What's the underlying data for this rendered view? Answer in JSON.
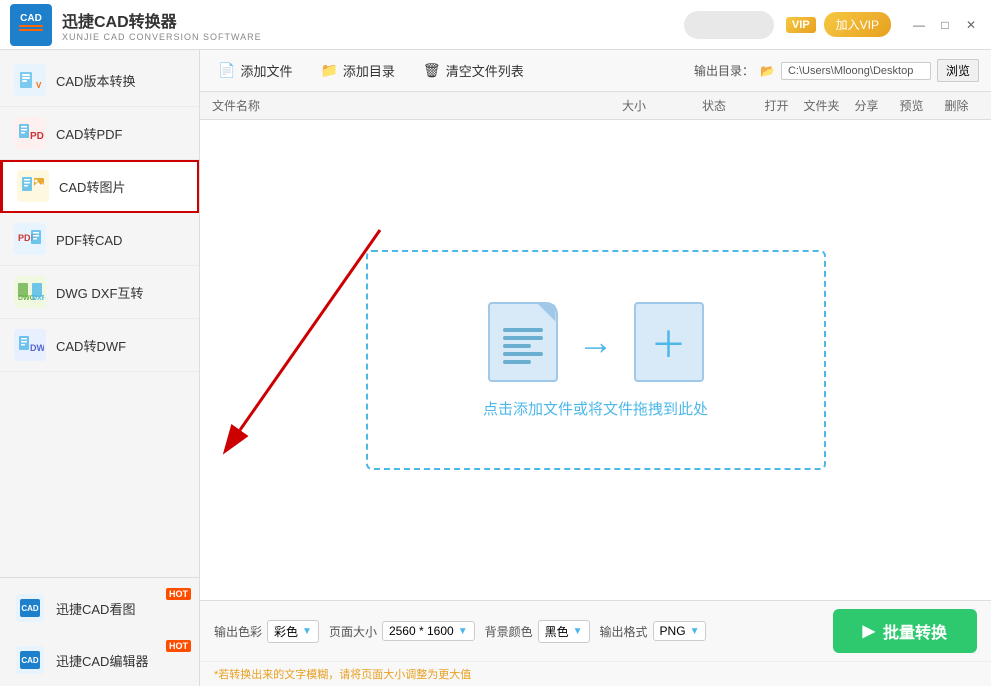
{
  "app": {
    "logo_line1": "CAD",
    "title": "迅捷CAD转换器",
    "subtitle": "XUNJIE CAD CONVERSION SOFTWARE"
  },
  "title_bar": {
    "vip_badge": "VIP",
    "join_vip": "加入VIP",
    "minimize": "—",
    "maximize": "□",
    "close": "✕"
  },
  "sidebar": {
    "items": [
      {
        "id": "cad-version",
        "label": "CAD版本转换",
        "icon": "version"
      },
      {
        "id": "cad-pdf",
        "label": "CAD转PDF",
        "icon": "pdf"
      },
      {
        "id": "cad-img",
        "label": "CAD转图片",
        "icon": "img",
        "active": true
      },
      {
        "id": "pdf-cad",
        "label": "PDF转CAD",
        "icon": "pdf-cad"
      },
      {
        "id": "dwg-dxf",
        "label": "DWG DXF互转",
        "icon": "dwg-dxf"
      },
      {
        "id": "cad-dwf",
        "label": "CAD转DWF",
        "icon": "dwf"
      }
    ],
    "apps": [
      {
        "id": "cad-viewer",
        "label": "迅捷CAD看图",
        "hot": "HOT"
      },
      {
        "id": "cad-editor",
        "label": "迅捷CAD编辑器",
        "hot": "HOT"
      }
    ]
  },
  "toolbar": {
    "add_file": "添加文件",
    "add_dir": "添加目录",
    "clear_list": "清空文件列表",
    "output_dir_label": "输出目录：",
    "output_dir_value": "C:\\Users\\Mloong\\Desktop",
    "browse": "浏览"
  },
  "file_list": {
    "col_name": "文件名称",
    "col_size": "大小",
    "col_status": "状态",
    "col_open": "打开",
    "col_folder": "文件夹",
    "col_share": "分享",
    "col_preview": "预览",
    "col_delete": "删除"
  },
  "drop_zone": {
    "text": "点击添加文件或将文件拖拽到此处"
  },
  "settings": {
    "color_label": "输出色彩",
    "color_value": "彩色",
    "page_size_label": "页面大小",
    "page_size_value": "2560 * 1600",
    "bg_color_label": "背景颜色",
    "bg_color_value": "黑色",
    "format_label": "输出格式",
    "format_value": "PNG",
    "hint": "*若转换出来的文字模糊，请将页面大小调整为更大值",
    "convert_btn": "批量转换"
  }
}
